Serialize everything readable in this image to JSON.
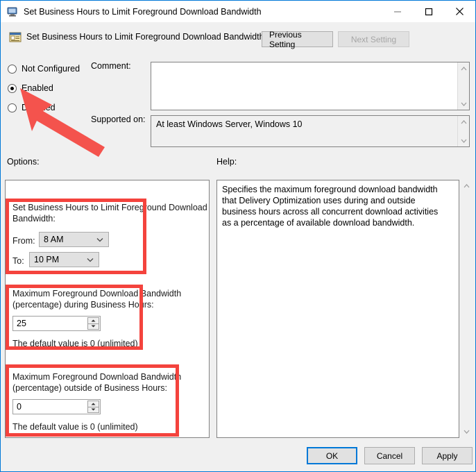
{
  "window": {
    "title": "Set Business Hours to Limit Foreground Download Bandwidth",
    "titlebar_icon": "policy-setting-icon",
    "minimize_icon": "minimize-icon",
    "maximize_icon": "maximize-icon",
    "close_icon": "close-icon"
  },
  "header": {
    "icon": "policy-setting-icon",
    "title": "Set Business Hours to Limit Foreground Download Bandwidth",
    "previous_setting_label": "Previous Setting",
    "next_setting_label": "Next Setting"
  },
  "state": {
    "not_configured_label": "Not Configured",
    "enabled_label": "Enabled",
    "disabled_label": "Disabled",
    "selected": "Enabled"
  },
  "comment": {
    "label": "Comment:",
    "value": "",
    "placeholder": ""
  },
  "supported_on": {
    "label": "Supported on:",
    "value": "At least Windows Server, Windows 10"
  },
  "panels": {
    "options_label": "Options:",
    "help_label": "Help:"
  },
  "options": {
    "business_hours": {
      "title_line1": "Set Business Hours to Limit Foreground Download",
      "title_line2": "Bandwidth:",
      "from_label": "From:",
      "from_value": "8 AM",
      "to_label": "To:",
      "to_value": "10 PM",
      "dropdown_icon": "chevron-down-icon"
    },
    "during_business": {
      "title_line1": "Maximum Foreground Download Bandwidth",
      "title_line2": "(percentage) during Business Hours:",
      "value": "25",
      "default_note": "The default value is 0 (unlimited)",
      "spin_up_icon": "spinner-up-icon",
      "spin_down_icon": "spinner-down-icon"
    },
    "outside_business": {
      "title_line1": "Maximum Foreground Download Bandwidth",
      "title_line2": "(percentage) outside of Business Hours:",
      "value": "0",
      "default_note": "The default value is 0 (unlimited)",
      "spin_up_icon": "spinner-up-icon",
      "spin_down_icon": "spinner-down-icon"
    }
  },
  "help": {
    "text": "Specifies the maximum foreground download bandwidth that Delivery Optimization uses during and outside business hours across all concurrent download activities as a percentage of available download bandwidth."
  },
  "footer": {
    "ok_label": "OK",
    "cancel_label": "Cancel",
    "apply_label": "Apply"
  },
  "annotations": {
    "highlight_color": "#f4433d",
    "arrow": "red-arrow-pointing-to-enabled-radio",
    "boxes": [
      "business-hours-highlight",
      "during-business-hours-highlight",
      "outside-business-hours-highlight"
    ]
  }
}
